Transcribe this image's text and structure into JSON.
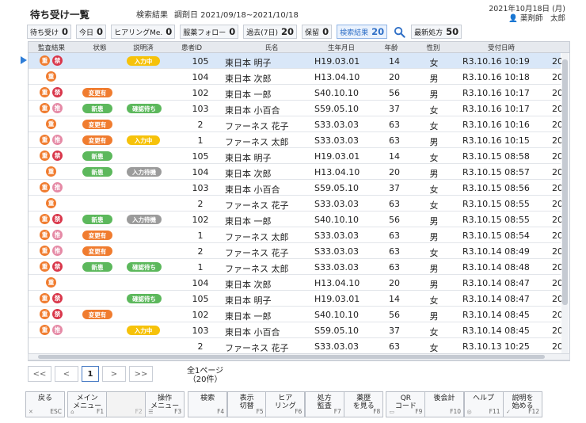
{
  "header": {
    "title": "待ち受け一覧",
    "subtitle": "検索結果",
    "period": "調剤日 2021/09/18~2021/10/18",
    "date": "2021年10月18日 (月)",
    "user": "薬剤師　太郎"
  },
  "filters": [
    {
      "label": "待ち受け",
      "count": "0"
    },
    {
      "label": "今日",
      "count": "0"
    },
    {
      "label": "ヒアリングMe.",
      "count": "0"
    },
    {
      "label": "服薬フォロー",
      "count": "0"
    },
    {
      "label": "過去(7日)",
      "count": "20"
    },
    {
      "label": "保留",
      "count": "0"
    },
    {
      "label": "検索結果",
      "count": "20",
      "active": true
    },
    {
      "label": "最新処方",
      "count": "50"
    }
  ],
  "columns": [
    "監査結果",
    "状態",
    "説明済",
    "患者ID",
    "氏名",
    "生年月日",
    "年齢",
    "性別",
    "受付日時"
  ],
  "badges": {
    "jyu": "重",
    "kin": "禁",
    "ki": "推"
  },
  "pills": {
    "henko": "変更有",
    "shin": "新患",
    "nyu": "入力中",
    "kaku": "確認待ち",
    "tai": "入力待機"
  },
  "rows": [
    {
      "badges": [
        "jyu",
        "kin"
      ],
      "state": "",
      "expl": "nyu",
      "id": "105",
      "name": "東日本 明子",
      "birth": "H19.03.01",
      "age": "14",
      "sex": "女",
      "time": "R3.10.16 10:19",
      "extra": "20",
      "sel": true
    },
    {
      "badges": [
        "jyu"
      ],
      "state": "",
      "expl": "",
      "id": "104",
      "name": "東日本 次郎",
      "birth": "H13.04.10",
      "age": "20",
      "sex": "男",
      "time": "R3.10.16 10:18",
      "extra": "20"
    },
    {
      "badges": [
        "jyu",
        "kin"
      ],
      "state": "henko",
      "expl": "",
      "id": "102",
      "name": "東日本 一郎",
      "birth": "S40.10.10",
      "age": "56",
      "sex": "男",
      "time": "R3.10.16 10:17",
      "extra": "20"
    },
    {
      "badges": [
        "jyu",
        "ki"
      ],
      "state": "shin",
      "expl": "kaku",
      "id": "103",
      "name": "東日本 小百合",
      "birth": "S59.05.10",
      "age": "37",
      "sex": "女",
      "time": "R3.10.16 10:17",
      "extra": "20"
    },
    {
      "badges": [
        "jyu"
      ],
      "state": "henko",
      "expl": "",
      "id": "2",
      "name": "ファーネス 花子",
      "birth": "S33.03.03",
      "age": "63",
      "sex": "女",
      "time": "R3.10.16 10:16",
      "extra": "20"
    },
    {
      "badges": [
        "jyu",
        "ki"
      ],
      "state": "henko",
      "expl": "nyu",
      "id": "1",
      "name": "ファーネス 太郎",
      "birth": "S33.03.03",
      "age": "63",
      "sex": "男",
      "time": "R3.10.16 10:15",
      "extra": "20"
    },
    {
      "badges": [
        "jyu",
        "kin"
      ],
      "state": "shin",
      "expl": "",
      "id": "105",
      "name": "東日本 明子",
      "birth": "H19.03.01",
      "age": "14",
      "sex": "女",
      "time": "R3.10.15 08:58",
      "extra": "20"
    },
    {
      "badges": [
        "jyu"
      ],
      "state": "shin",
      "expl": "tai",
      "id": "104",
      "name": "東日本 次郎",
      "birth": "H13.04.10",
      "age": "20",
      "sex": "男",
      "time": "R3.10.15 08:57",
      "extra": "20"
    },
    {
      "badges": [
        "jyu",
        "ki"
      ],
      "state": "",
      "expl": "",
      "id": "103",
      "name": "東日本 小百合",
      "birth": "S59.05.10",
      "age": "37",
      "sex": "女",
      "time": "R3.10.15 08:56",
      "extra": "20"
    },
    {
      "badges": [
        "jyu"
      ],
      "state": "",
      "expl": "",
      "id": "2",
      "name": "ファーネス 花子",
      "birth": "S33.03.03",
      "age": "63",
      "sex": "女",
      "time": "R3.10.15 08:55",
      "extra": "20"
    },
    {
      "badges": [
        "jyu",
        "kin"
      ],
      "state": "shin",
      "expl": "tai",
      "id": "102",
      "name": "東日本 一郎",
      "birth": "S40.10.10",
      "age": "56",
      "sex": "男",
      "time": "R3.10.15 08:55",
      "extra": "20"
    },
    {
      "badges": [
        "jyu",
        "ki"
      ],
      "state": "henko",
      "expl": "",
      "id": "1",
      "name": "ファーネス 太郎",
      "birth": "S33.03.03",
      "age": "63",
      "sex": "男",
      "time": "R3.10.15 08:54",
      "extra": "20"
    },
    {
      "badges": [
        "jyu",
        "ki"
      ],
      "state": "henko",
      "expl": "",
      "id": "2",
      "name": "ファーネス 花子",
      "birth": "S33.03.03",
      "age": "63",
      "sex": "女",
      "time": "R3.10.14 08:49",
      "extra": "20"
    },
    {
      "badges": [
        "jyu",
        "kin"
      ],
      "state": "shin",
      "expl": "kaku",
      "id": "1",
      "name": "ファーネス 太郎",
      "birth": "S33.03.03",
      "age": "63",
      "sex": "男",
      "time": "R3.10.14 08:48",
      "extra": "20"
    },
    {
      "badges": [
        "jyu"
      ],
      "state": "",
      "expl": "",
      "id": "104",
      "name": "東日本 次郎",
      "birth": "H13.04.10",
      "age": "20",
      "sex": "男",
      "time": "R3.10.14 08:47",
      "extra": "20"
    },
    {
      "badges": [
        "jyu",
        "kin"
      ],
      "state": "",
      "expl": "kaku",
      "id": "105",
      "name": "東日本 明子",
      "birth": "H19.03.01",
      "age": "14",
      "sex": "女",
      "time": "R3.10.14 08:47",
      "extra": "20"
    },
    {
      "badges": [
        "jyu",
        "kin"
      ],
      "state": "henko",
      "expl": "",
      "id": "102",
      "name": "東日本 一郎",
      "birth": "S40.10.10",
      "age": "56",
      "sex": "男",
      "time": "R3.10.14 08:45",
      "extra": "20"
    },
    {
      "badges": [
        "jyu",
        "ki"
      ],
      "state": "",
      "expl": "nyu",
      "id": "103",
      "name": "東日本 小百合",
      "birth": "S59.05.10",
      "age": "37",
      "sex": "女",
      "time": "R3.10.14 08:45",
      "extra": "20"
    },
    {
      "badges": [],
      "state": "",
      "expl": "",
      "id": "2",
      "name": "ファーネス 花子",
      "birth": "S33.03.03",
      "age": "63",
      "sex": "女",
      "time": "R3.10.13 10:25",
      "extra": "20"
    }
  ],
  "pager": {
    "first": "<<",
    "prev": "<",
    "current": "1",
    "next": ">",
    "last": ">>",
    "info": "全1ページ",
    "count": "（20件）"
  },
  "fkeys": [
    {
      "label": "戻る",
      "key": "ESC",
      "icon": "✕"
    },
    {
      "label": "メイン\nメニュー",
      "key": "F1",
      "icon": "⌂"
    },
    {
      "label": "",
      "key": "F2",
      "disabled": true
    },
    {
      "label": "操作\nメニュー",
      "key": "F3",
      "icon": "☰"
    },
    {
      "label": "検索",
      "key": "F4"
    },
    {
      "label": "表示\n切替",
      "key": "F5"
    },
    {
      "label": "ヒア\nリング",
      "key": "F6"
    },
    {
      "label": "処方\n監査",
      "key": "F7"
    },
    {
      "label": "薬歴\nを見る",
      "key": "F8"
    },
    {
      "label": "QR\nコード",
      "key": "F9",
      "icon": "▭"
    },
    {
      "label": "後会計",
      "key": "F10"
    },
    {
      "label": "ヘルプ",
      "key": "F11",
      "icon": "◎"
    },
    {
      "label": "説明を\n始める",
      "key": "F12",
      "icon": "✓"
    }
  ]
}
